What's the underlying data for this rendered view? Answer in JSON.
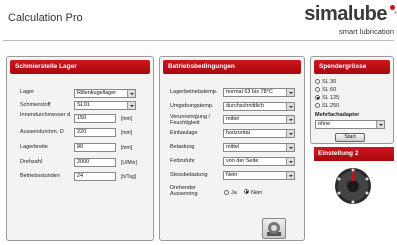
{
  "app": {
    "title": "Calculation Pro"
  },
  "logo": {
    "word": "simalube",
    "registered": "®",
    "tagline": "smart lubrication"
  },
  "panel1": {
    "header": "Schmierstelle Lager",
    "fields": [
      {
        "label": "Lager",
        "value": "Rillenkugellager",
        "type": "select"
      },
      {
        "label": "Schmierstoff",
        "value": "SL01",
        "type": "select"
      },
      {
        "label": "Innendurchmesser d",
        "value": "150",
        "unit": "[mm]",
        "type": "input"
      },
      {
        "label": "Aussendurchm. D",
        "value": "220",
        "unit": "[mm]",
        "type": "input"
      },
      {
        "label": "Lagerbreite",
        "value": "80",
        "unit": "[mm]",
        "type": "input"
      },
      {
        "label": "Drehzahl",
        "value": "2000",
        "unit": "[U/Min]",
        "type": "input"
      },
      {
        "label": "Betriebsstunden",
        "value": "24",
        "unit": "[h/Tag]",
        "type": "input"
      }
    ]
  },
  "panel2": {
    "header": "Betriebsbedingungen",
    "fields": [
      {
        "label": "Lagerbetriebstemp.",
        "value": "normal 63 bis 78°C"
      },
      {
        "label": "Umgebungstemp.",
        "value": "durchschnittlich"
      },
      {
        "label": "Verunreinigung / Feuchtigkeit",
        "value": "mittel"
      },
      {
        "label": "Einbaulage",
        "value": "horizontal"
      },
      {
        "label": "Belastung",
        "value": "mittel"
      },
      {
        "label": "Fettzufuhr",
        "value": "von der Seite"
      },
      {
        "label": "Stossbelastung",
        "value": "Nein"
      }
    ],
    "radio_label": "Drehender Aussenring",
    "radio_options": [
      "Ja",
      "Nein"
    ],
    "radio_selected": "Nein"
  },
  "panel3": {
    "header": "Spendergrösse",
    "sizes": [
      "SL 30",
      "SL 60",
      "SL 125",
      "SL 250"
    ],
    "selected_size": "SL 125",
    "adapter_label": "Mehrfachadapter",
    "adapter_value": "ohne",
    "start_label": "Start"
  },
  "setting": {
    "label": "Einstellung 2"
  },
  "colors": {
    "accent": "#c0121b",
    "panel_bg": "#f3f3f3"
  }
}
